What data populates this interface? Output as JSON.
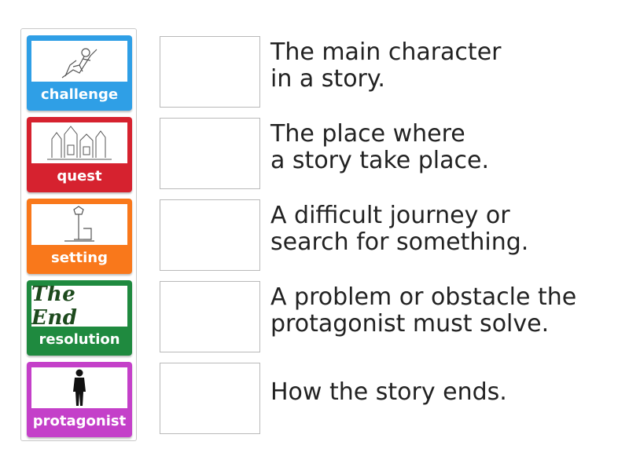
{
  "cards": [
    {
      "label": "challenge",
      "color": "#2f9fe6",
      "icon": "climber-sketch-icon"
    },
    {
      "label": "quest",
      "color": "#d6222f",
      "icon": "castle-sketch-icon"
    },
    {
      "label": "setting",
      "color": "#f9781b",
      "icon": "street-lamp-sketch-icon"
    },
    {
      "label": "resolution",
      "color": "#1f8a3f",
      "icon": "the-end-text-icon",
      "image_text": "The End"
    },
    {
      "label": "protagonist",
      "color": "#c440c9",
      "icon": "person-silhouette-icon"
    }
  ],
  "definitions": [
    "The main character\nin a story.",
    "The place where\na story take place.",
    "A difficult journey or\nsearch for something.",
    "A problem or obstacle the\nprotagonist must solve.",
    "How the story ends."
  ]
}
